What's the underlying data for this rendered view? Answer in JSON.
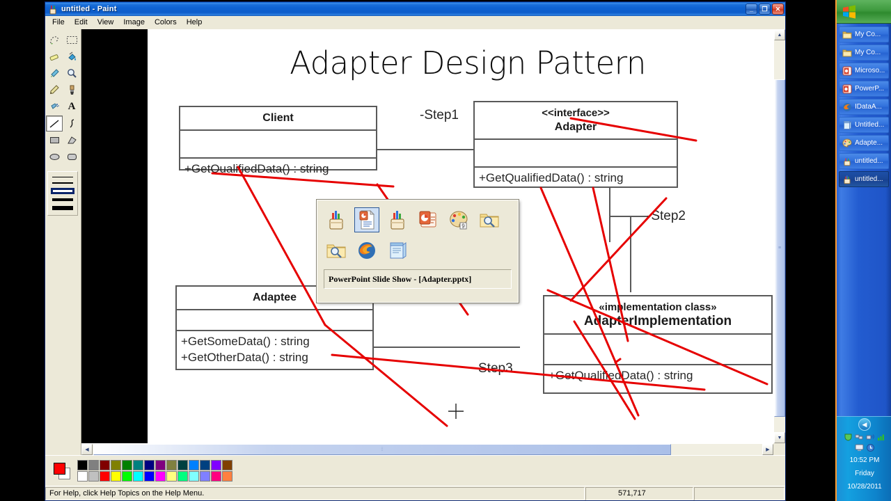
{
  "window": {
    "title": "untitled - Paint",
    "icon": "paint-icon",
    "controls": {
      "minimize": "_",
      "restore": "❐",
      "close": "✕"
    },
    "menus": [
      {
        "label": "File"
      },
      {
        "label": "Edit"
      },
      {
        "label": "View"
      },
      {
        "label": "Image"
      },
      {
        "label": "Colors"
      },
      {
        "label": "Help"
      }
    ]
  },
  "toolbox": {
    "tools": [
      {
        "name": "free-form-select-tool",
        "selected": false
      },
      {
        "name": "rectangle-select-tool",
        "selected": false
      },
      {
        "name": "eraser-tool",
        "selected": false
      },
      {
        "name": "fill-with-color-tool",
        "selected": false
      },
      {
        "name": "pick-color-tool",
        "selected": false
      },
      {
        "name": "magnifier-tool",
        "selected": false
      },
      {
        "name": "pencil-tool",
        "selected": false
      },
      {
        "name": "brush-tool",
        "selected": false
      },
      {
        "name": "airbrush-tool",
        "selected": false
      },
      {
        "name": "text-tool",
        "selected": false
      },
      {
        "name": "line-tool",
        "selected": true
      },
      {
        "name": "curve-tool",
        "selected": false
      },
      {
        "name": "rectangle-tool",
        "selected": false
      },
      {
        "name": "polygon-tool",
        "selected": false
      },
      {
        "name": "ellipse-tool",
        "selected": false
      },
      {
        "name": "rounded-rectangle-tool",
        "selected": false
      }
    ],
    "line_widths": [
      1,
      2,
      3,
      5,
      8
    ],
    "selected_width_index": 2
  },
  "slide": {
    "title": "Adapter Design Pattern",
    "classes": [
      {
        "id": "client",
        "stereotype": "",
        "name": "Client",
        "attributes": [],
        "operations": [
          "+GetQualifiedData() : string"
        ]
      },
      {
        "id": "adapter",
        "stereotype": "<<interface>>",
        "name": "Adapter",
        "attributes": [],
        "operations": [
          "+GetQualifiedData() : string"
        ]
      },
      {
        "id": "adaptee",
        "stereotype": "",
        "name": "Adaptee",
        "attributes": [],
        "operations": [
          "+GetSomeData() : string",
          "+GetOtherData() : string"
        ]
      },
      {
        "id": "adapterimpl",
        "stereotype": "«implementation class»",
        "name": "AdapterImplementation",
        "attributes": [],
        "operations": [
          "+GetQualifiedData() : string"
        ]
      }
    ],
    "connector_labels": [
      {
        "id": "step1",
        "text": "-Step1"
      },
      {
        "id": "step2",
        "text": "-Step2"
      },
      {
        "id": "step3",
        "text": "Step3"
      }
    ],
    "annotation_color": "#e60000"
  },
  "switcher": {
    "items": [
      {
        "name": "paint-icon",
        "selected": false
      },
      {
        "name": "powerpoint-document-icon",
        "selected": true
      },
      {
        "name": "paint-icon",
        "selected": false
      },
      {
        "name": "powerpoint-icon",
        "selected": false
      },
      {
        "name": "paint-palette-icon",
        "selected": false
      },
      {
        "name": "folder-search-icon",
        "selected": false
      },
      {
        "name": "folder-search-icon",
        "selected": false
      },
      {
        "name": "firefox-icon",
        "selected": false
      },
      {
        "name": "notepad-icon",
        "selected": false
      }
    ],
    "selected_label": "PowerPoint Slide Show - [Adapter.pptx]"
  },
  "palette": {
    "foreground_color": "#ff0000",
    "background_color": "#ffffff",
    "row_top": [
      "#000000",
      "#808080",
      "#800000",
      "#808000",
      "#008000",
      "#008080",
      "#000080",
      "#800080",
      "#808040",
      "#004040",
      "#0080ff",
      "#004080",
      "#8000ff",
      "#804000"
    ],
    "row_bottom": [
      "#ffffff",
      "#c0c0c0",
      "#ff0000",
      "#ffff00",
      "#00ff00",
      "#00ffff",
      "#0000ff",
      "#ff00ff",
      "#ffff80",
      "#00ff80",
      "#80ffff",
      "#8080ff",
      "#ff0080",
      "#ff8040"
    ]
  },
  "statusbar": {
    "help_text": "For Help, click Help Topics on the Help Menu.",
    "size_text": "",
    "coordinates": "571,717"
  },
  "taskbar": {
    "start_label": "",
    "items": [
      {
        "label": "My Co...",
        "icon": "folder-icon",
        "active": false
      },
      {
        "label": "My Co...",
        "icon": "folder-icon",
        "active": false
      },
      {
        "label": "Microso...",
        "icon": "access-icon",
        "active": false
      },
      {
        "label": "PowerP...",
        "icon": "powerpoint-icon",
        "active": false
      },
      {
        "label": "IDataA...",
        "icon": "firefox-icon",
        "active": false
      },
      {
        "label": "Untitled...",
        "icon": "notepad-icon",
        "active": false
      },
      {
        "label": "Adapte...",
        "icon": "paint-palette-icon",
        "active": false
      },
      {
        "label": "untitled...",
        "icon": "paint-icon",
        "active": false
      },
      {
        "label": "untitled...",
        "icon": "paint-icon",
        "active": true
      }
    ],
    "tray": {
      "expand_icon": "chevron-left-icon",
      "icons": [
        "shield-icon",
        "network-icon",
        "wireless-icon",
        "signal-icon",
        "display-icon",
        "update-icon"
      ],
      "time": "10:52 PM",
      "day": "Friday",
      "date": "10/28/2011"
    }
  }
}
